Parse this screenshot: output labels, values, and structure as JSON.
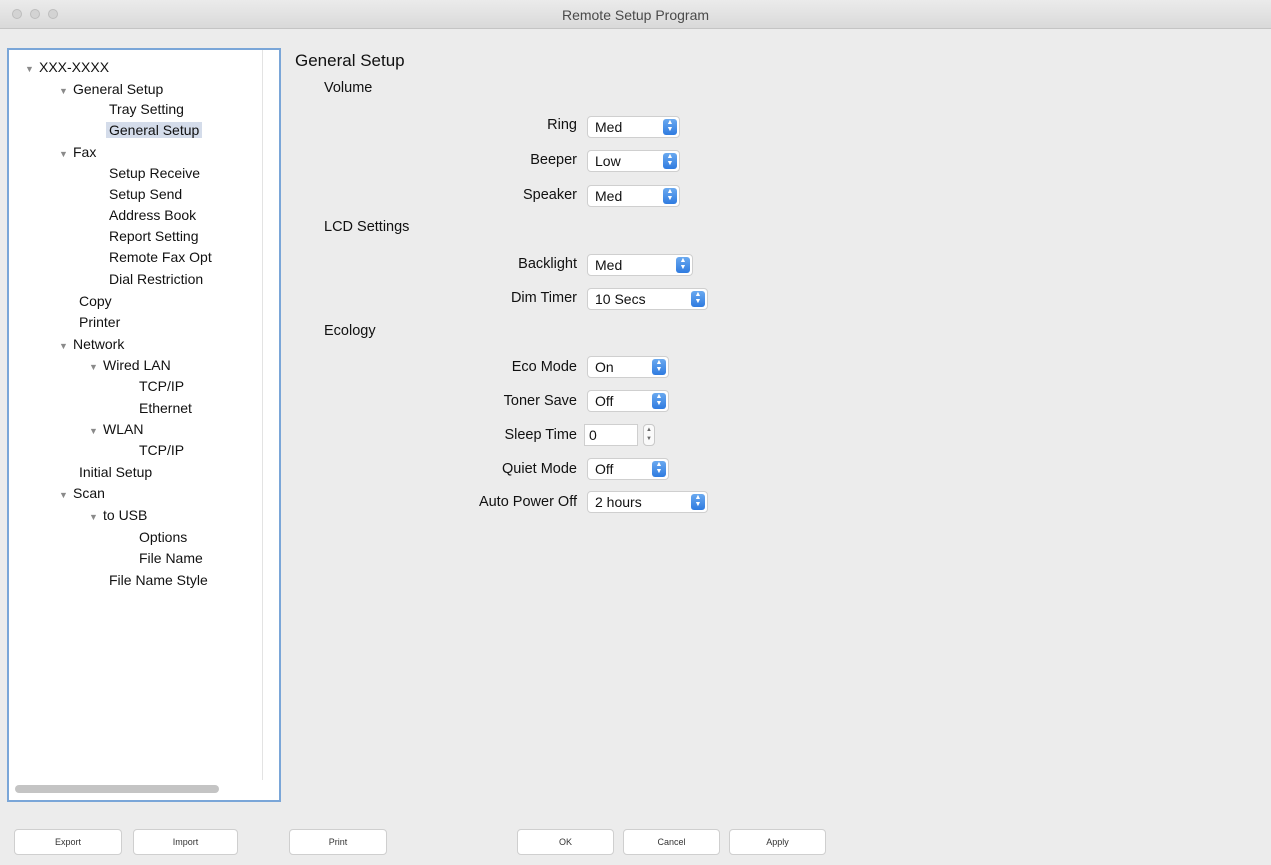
{
  "window": {
    "title": "Remote Setup Program"
  },
  "tree": [
    {
      "label": "XXX-XXXX",
      "arrow": true
    },
    {
      "label": "General Setup",
      "arrow": true
    },
    {
      "label": "Tray Setting",
      "arrow": false
    },
    {
      "label": "General Setup",
      "arrow": false,
      "selected": true
    },
    {
      "label": "Fax",
      "arrow": true
    },
    {
      "label": "Setup Receive",
      "arrow": false
    },
    {
      "label": "Setup Send",
      "arrow": false
    },
    {
      "label": "Address Book",
      "arrow": false
    },
    {
      "label": "Report Setting",
      "arrow": false
    },
    {
      "label": "Remote Fax Opt",
      "arrow": false
    },
    {
      "label": "Dial Restriction",
      "arrow": false
    },
    {
      "label": "Copy",
      "arrow": false
    },
    {
      "label": "Printer",
      "arrow": false
    },
    {
      "label": "Network",
      "arrow": true
    },
    {
      "label": "Wired LAN",
      "arrow": true
    },
    {
      "label": "TCP/IP",
      "arrow": false
    },
    {
      "label": "Ethernet",
      "arrow": false
    },
    {
      "label": "WLAN",
      "arrow": true
    },
    {
      "label": "TCP/IP",
      "arrow": false
    },
    {
      "label": "Initial Setup",
      "arrow": false
    },
    {
      "label": "Scan",
      "arrow": true
    },
    {
      "label": "to USB",
      "arrow": true
    },
    {
      "label": "Options",
      "arrow": false
    },
    {
      "label": "File Name",
      "arrow": false
    },
    {
      "label": "File Name Style",
      "arrow": false
    }
  ],
  "main": {
    "title": "General Setup",
    "volume": {
      "heading": "Volume",
      "ring_label": "Ring",
      "ring_value": "Med",
      "beeper_label": "Beeper",
      "beeper_value": "Low",
      "speaker_label": "Speaker",
      "speaker_value": "Med"
    },
    "lcd": {
      "heading": "LCD Settings",
      "backlight_label": "Backlight",
      "backlight_value": "Med",
      "dimtimer_label": "Dim Timer",
      "dimtimer_value": "10 Secs"
    },
    "ecology": {
      "heading": "Ecology",
      "eco_label": "Eco Mode",
      "eco_value": "On",
      "toner_label": "Toner Save",
      "toner_value": "Off",
      "sleep_label": "Sleep Time",
      "sleep_value": "0",
      "quiet_label": "Quiet Mode",
      "quiet_value": "Off",
      "autopower_label": "Auto Power Off",
      "autopower_value": "2 hours"
    }
  },
  "buttons": {
    "export": "Export",
    "import": "Import",
    "print": "Print",
    "ok": "OK",
    "cancel": "Cancel",
    "apply": "Apply"
  },
  "colors": {
    "accent": "#2f7be0",
    "selection": "#d4dcea",
    "focus_border": "#7aa6d8"
  }
}
